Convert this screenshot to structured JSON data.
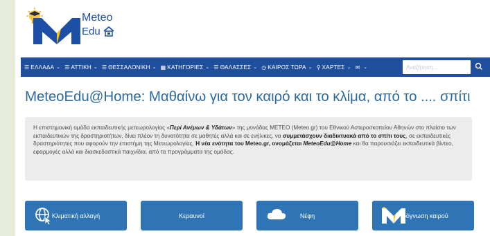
{
  "logo": {
    "word1": "Meteo",
    "word2": "Edu"
  },
  "nav": {
    "items": [
      {
        "label": "ΕΛΛΑΔΑ",
        "icon": "list-icon"
      },
      {
        "label": "ΑΤΤΙΚΗ",
        "icon": "list-icon"
      },
      {
        "label": "ΘΕΣΣΑΛΟΝΙΚΗ",
        "icon": "list-icon"
      },
      {
        "label": "ΚΑΤΗΓΟΡΙΕΣ",
        "icon": "grid-icon"
      },
      {
        "label": "ΘΑΛΑΣΣΕΣ",
        "icon": "list-icon"
      },
      {
        "label": "ΚΑΙΡΟΣ ΤΩΡΑ",
        "icon": "clock-icon"
      },
      {
        "label": "ΧΑΡΤΕΣ",
        "icon": "map-pin-icon"
      },
      {
        "label": "",
        "icon": "mail-icon"
      }
    ],
    "search_placeholder": "Αναζήτηση..."
  },
  "main": {
    "title": "MeteoEdu@Home: Μαθαίνω για τον καιρό και το κλίμα, από το .... σπίτι",
    "info": {
      "p1": "Η επιστημονική ομάδα εκπαιδευτικής μετεωρολογίας «",
      "p2": "Περί Ανέμων & Υδάτων",
      "p3": "» της μονάδας ΜΕΤΕΟ (Meteo.gr) του Εθνικού Αστεροσκοπείου Αθηνών στο πλαίσιο των εκπαιδευτικών της δραστηριοτήτων, δίνει πλέον τη δυνατότητα σε μαθητές αλλά και σε ενήλικες, να ",
      "p4": "συμμετάσχουν διαδικτυακά από το σπίτι τους",
      "p5": ", σε εκπαιδευτικές δραστηριότητες που αφορούν την επιστήμη της Μετεωρολογίας. ",
      "p6": "Η νέα ενότητα του Meteo.gr, ονομάζεται ",
      "p7": "MeteoEdu@Home",
      "p8": " και θα παρουσιάζει εκπαιδευτικά βίντεο, εφαρμογές αλλά και διασκεδαστικά παιχνίδια, από τα προγράμματα της ομάδας."
    },
    "tiles": [
      {
        "label": "Κλιματική αλλαγή",
        "icon": "globe-cursor-icon"
      },
      {
        "label": "Κεραυνοί",
        "icon": ""
      },
      {
        "label": "Νέφη",
        "icon": "cloud-icon"
      },
      {
        "label": "Πρόγνωση καιρού",
        "icon": "meteo-m-icon"
      }
    ]
  },
  "colors": {
    "nav_bg": "#1f4e9c",
    "tile_bg": "#2f74b5",
    "title": "#2d6a9e",
    "info_bg": "#ececec",
    "page_bg": "#e6ecd9"
  }
}
